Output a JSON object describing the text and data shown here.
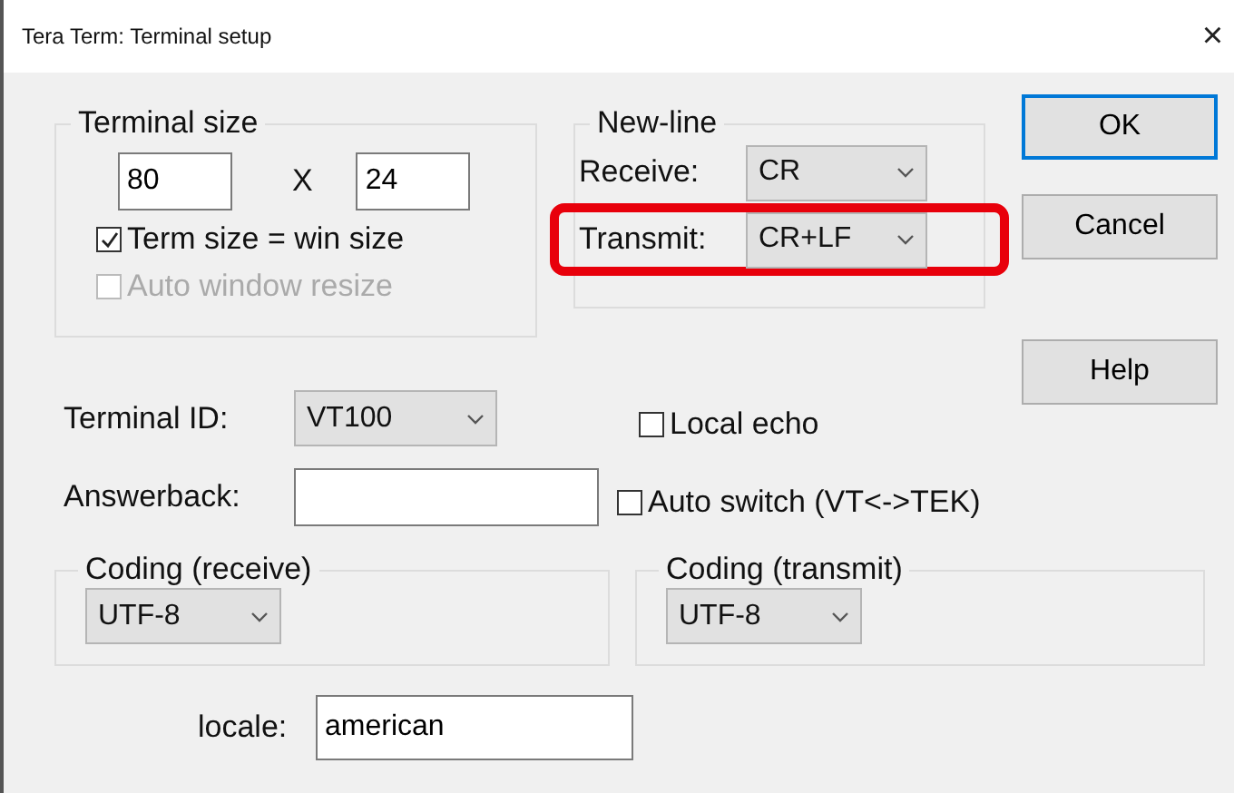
{
  "window": {
    "title": "Tera Term: Terminal setup",
    "close": "×"
  },
  "terminal_size": {
    "legend": "Terminal size",
    "columns": "80",
    "separator": "X",
    "rows": "24",
    "options": [
      {
        "label": "Term size = win size",
        "checked": true,
        "disabled": false
      },
      {
        "label": "Auto window resize",
        "checked": false,
        "disabled": true
      }
    ]
  },
  "new_line": {
    "legend": "New-line",
    "rows": [
      {
        "label": "Receive:",
        "value": "CR",
        "highlighted": false
      },
      {
        "label": "Transmit:",
        "value": "CR+LF",
        "highlighted": true
      }
    ]
  },
  "buttons": [
    {
      "label": "OK",
      "default": true
    },
    {
      "label": "Cancel",
      "default": false
    },
    {
      "label": "Help",
      "default": false
    }
  ],
  "terminal_id": {
    "label": "Terminal ID:",
    "value": "VT100"
  },
  "answerback": {
    "label": "Answerback:"
  },
  "checkboxes": [
    {
      "label": "Local echo",
      "checked": false
    },
    {
      "label": "Auto switch (VT<->TEK)",
      "checked": false
    }
  ],
  "coding": [
    {
      "legend": "Coding (receive)",
      "value": "UTF-8"
    },
    {
      "legend": "Coding (transmit)",
      "value": "UTF-8"
    }
  ],
  "locale": {
    "label": "locale:",
    "value": "american"
  }
}
